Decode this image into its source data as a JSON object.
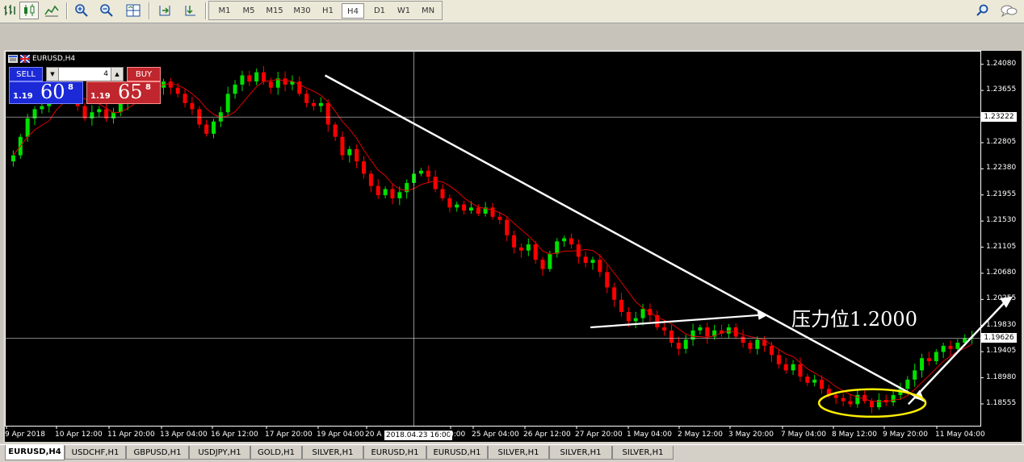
{
  "toolbar": {
    "timeframes": [
      "M1",
      "M5",
      "M15",
      "M30",
      "H1",
      "H4",
      "D1",
      "W1",
      "MN"
    ],
    "active_timeframe": "H4"
  },
  "chart_window": {
    "title": "EURUSD,H4",
    "one_click": {
      "sell_label": "SELL",
      "buy_label": "BUY",
      "lot": "4",
      "sell_prefix": "1.19",
      "sell_big": "60",
      "sell_sup": "8",
      "buy_prefix": "1.19",
      "buy_big": "65",
      "buy_sup": "8"
    },
    "annotation": "压力位1.2000",
    "crosshair_date": "2018.04.23 16:00",
    "crosshair_price": "1.23222",
    "current_price": "1.19626"
  },
  "tabs": [
    "EURUSD,H4",
    "USDCHF,H1",
    "GBPUSD,H1",
    "USDJPY,H1",
    "GOLD,H1",
    "SILVER,H1",
    "EURUSD,H1",
    "EURUSD,H1",
    "SILVER,H1",
    "SILVER,H1",
    "SILVER,H1"
  ],
  "active_tab": "EURUSD,H4",
  "colors": {
    "background": "#000000",
    "bull": "#00e000",
    "bear": "#ff0000",
    "ma": "#e00000",
    "trendline": "#ffffff",
    "ellipse": "#ffee00",
    "sell": "#1b29d6",
    "buy": "#c0262d"
  },
  "chart_data": {
    "type": "candlestick",
    "symbol": "EURUSD",
    "timeframe": "H4",
    "y_ticks": [
      "1.24080",
      "1.23655",
      "1.23222",
      "1.22805",
      "1.22380",
      "1.21955",
      "1.21530",
      "1.21105",
      "1.20680",
      "1.20255",
      "1.19830",
      "1.19626",
      "1.19405",
      "1.18980",
      "1.18555"
    ],
    "ylim": [
      1.182,
      1.243
    ],
    "x_ticks": [
      "9 Apr 2018",
      "10 Apr 12:00",
      "11 Apr 20:00",
      "13 Apr 04:00",
      "16 Apr 12:00",
      "17 Apr 20:00",
      "19 Apr 04:00",
      "20 A",
      "0:00",
      "25 Apr 04:00",
      "26 Apr 12:00",
      "27 Apr 20:00",
      "1 May 04:00",
      "2 May 12:00",
      "3 May 20:00",
      "7 May 04:00",
      "8 May 12:00",
      "9 May 20:00",
      "11 May 04:00"
    ],
    "close_path": [
      1.226,
      1.229,
      1.232,
      1.2335,
      1.234,
      1.235,
      1.2365,
      1.236,
      1.2375,
      1.234,
      1.232,
      1.233,
      1.2335,
      1.232,
      1.233,
      1.2345,
      1.236,
      1.2375,
      1.238,
      1.2385,
      1.237,
      1.238,
      1.237,
      1.236,
      1.2345,
      1.2335,
      1.231,
      1.2295,
      1.2315,
      1.233,
      1.236,
      1.2375,
      1.239,
      1.238,
      1.2395,
      1.238,
      1.237,
      1.2385,
      1.2375,
      1.238,
      1.236,
      1.2345,
      1.234,
      1.2345,
      1.231,
      1.229,
      1.226,
      1.227,
      1.225,
      1.223,
      1.221,
      1.2195,
      1.2205,
      1.219,
      1.22,
      1.2215,
      1.223,
      1.2235,
      1.2225,
      1.2205,
      1.219,
      1.2175,
      1.218,
      1.217,
      1.2175,
      1.2165,
      1.2175,
      1.216,
      1.2155,
      1.213,
      1.211,
      1.2105,
      1.2115,
      1.209,
      1.2075,
      1.21,
      1.212,
      1.2125,
      1.2115,
      1.2095,
      1.2085,
      1.209,
      1.207,
      1.2045,
      1.2025,
      1.2005,
      1.199,
      1.1995,
      1.201,
      1.2,
      1.198,
      1.1975,
      1.1955,
      1.1945,
      1.196,
      1.1975,
      1.198,
      1.1965,
      1.1975,
      1.197,
      1.198,
      1.1965,
      1.1955,
      1.1945,
      1.196,
      1.195,
      1.1935,
      1.192,
      1.191,
      1.192,
      1.19,
      1.189,
      1.1895,
      1.188,
      1.187,
      1.1865,
      1.186,
      1.1855,
      1.187,
      1.186,
      1.185,
      1.1862,
      1.1858,
      1.187,
      1.188,
      1.1895,
      1.191,
      1.193,
      1.1925,
      1.194,
      1.195,
      1.1945,
      1.1955,
      1.1962,
      1.1963
    ],
    "ma_period_hint": "short moving average",
    "trendlines": [
      {
        "from": [
          "19 Apr 04:00",
          1.239
        ],
        "to": [
          "9 May 20:00",
          1.186
        ]
      },
      {
        "from": [
          "1 May 04:00",
          1.198
        ],
        "to": [
          "3 May 20:00",
          1.2
        ]
      },
      {
        "from": [
          "9 May 20:00",
          1.1855
        ],
        "to": [
          "11 May 04:00",
          1.203
        ]
      }
    ],
    "horizontal_lines": [
      1.23222,
      1.19626
    ],
    "highlight": {
      "shape": "ellipse",
      "around": "8 May - 9 May lows"
    }
  }
}
